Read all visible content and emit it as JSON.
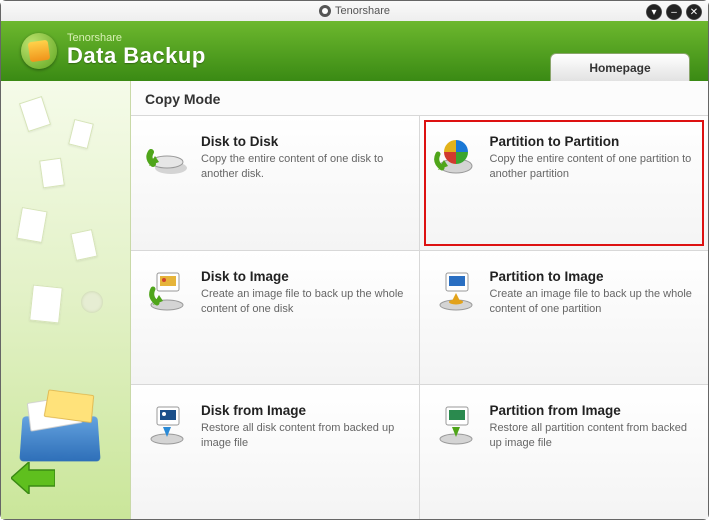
{
  "titlebar": {
    "brand": "Tenorshare"
  },
  "header": {
    "vendor": "Tenorshare",
    "product": "Data Backup",
    "tab_homepage": "Homepage"
  },
  "section_title": "Copy Mode",
  "options": {
    "disk_to_disk": {
      "title": "Disk to Disk",
      "desc": "Copy the entire content of one disk to another disk."
    },
    "part_to_part": {
      "title": "Partition to Partition",
      "desc": "Copy the entire content of one partition to another partition"
    },
    "disk_to_image": {
      "title": "Disk to Image",
      "desc": "Create an image file to back up the whole content of one disk"
    },
    "part_to_image": {
      "title": "Partition to Image",
      "desc": "Create an image file to back up the whole content of one partition"
    },
    "disk_from_image": {
      "title": "Disk from Image",
      "desc": "Restore all disk content from backed up image file"
    },
    "part_from_image": {
      "title": "Partition from Image",
      "desc": "Restore all partition content from backed up image file"
    }
  }
}
